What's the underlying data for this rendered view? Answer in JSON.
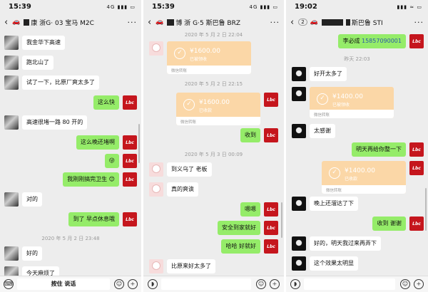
{
  "panels": [
    {
      "time": "15:39",
      "status_icons": "4G ▮▮▮ ▭",
      "title": "康 浙G·  03 宝马 M2C",
      "messages": [
        {
          "text": "我金华下高速"
        },
        {
          "text": "跑北山了"
        },
        {
          "text": "试了一下，比原厂爽太多了"
        },
        {
          "text": "这么快"
        },
        {
          "text": "高速很堵一路 80 开的"
        },
        {
          "text": "这么晚还堵啊"
        },
        {
          "text": "😜"
        },
        {
          "text": "我刚刚搞完卫生 😊"
        },
        {
          "text": "对的"
        },
        {
          "text": "到了 早点休息哦"
        },
        {
          "text": "好的"
        },
        {
          "text": "今天麻烦了"
        }
      ],
      "timestamp": "2020 年 5 月 2 日 23:48",
      "input_label": "按住 说话"
    },
    {
      "time": "15:39",
      "status_icons": "4G ▮▮▮ ▭",
      "title": "博 浙 G·5  斯巴鲁 BRZ",
      "timestamps": [
        "2020 年 5 月 2 日 22:04",
        "2020 年 5 月 2 日 22:15",
        "2020 年 5 月 3 日 00:09"
      ],
      "transfers": [
        {
          "amount": "¥1600.00",
          "status": "已被领收",
          "footer": "微信转账"
        },
        {
          "amount": "¥1600.00",
          "status": "已收款",
          "footer": "微信转账"
        }
      ],
      "messages": [
        {
          "text": "收到"
        },
        {
          "text": "到义乌了 老板"
        },
        {
          "text": "真的爽诶"
        },
        {
          "text": "嗯嗯"
        },
        {
          "text": "安全到家就好"
        },
        {
          "text": "哈哈 好就好"
        },
        {
          "text": "比原来好太多了"
        }
      ]
    },
    {
      "time": "19:02",
      "status_icons": "▮▮▮ ≈ ▭",
      "badge": "2",
      "title": "斯巴鲁 STI",
      "first_message": {
        "name": "李必成",
        "phone": "15857090001"
      },
      "timestamp": "昨天 22:03",
      "transfers": [
        {
          "amount": "¥1400.00",
          "status": "已被领收",
          "footer": "微信转账"
        },
        {
          "amount": "¥1400.00",
          "status": "已收款",
          "footer": "微信转账"
        }
      ],
      "messages": [
        {
          "text": "好开太多了"
        },
        {
          "text": "太感谢"
        },
        {
          "text": "明天再给你整一下"
        },
        {
          "text": "晚上还溜达了下"
        },
        {
          "text": "收到 谢谢"
        },
        {
          "text": "好的，明天我过来再弄下"
        },
        {
          "text": "这个效果太明显"
        }
      ]
    }
  ],
  "avatar_label": "Lbc",
  "icons": {
    "back": "back-chevron-icon",
    "more": "more-icon",
    "voice": "voice-icon",
    "emoji": "emoji-icon",
    "plus": "plus-icon",
    "transfer": "transfer-check-icon",
    "car": "car-icon"
  }
}
